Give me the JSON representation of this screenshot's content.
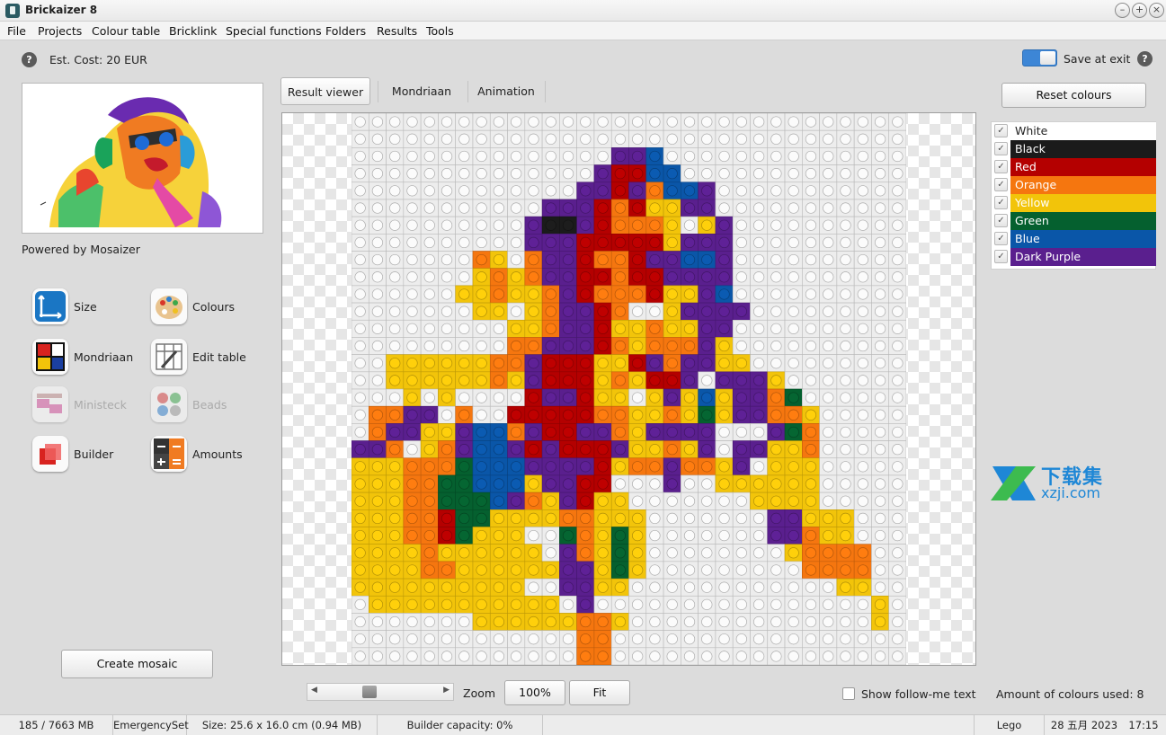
{
  "window": {
    "title": "Brickaizer 8"
  },
  "menu": [
    "File",
    "Projects",
    "Colour table",
    "Bricklink",
    "Special functions",
    "Folders",
    "Results",
    "Tools"
  ],
  "header": {
    "est_cost": "Est. Cost: 20 EUR",
    "save_at_exit": "Save at exit",
    "save_at_exit_on": true
  },
  "left": {
    "powered_by": "Powered by Mosaizer",
    "tools": {
      "size": "Size",
      "colours": "Colours",
      "mondriaan": "Mondriaan",
      "edit_table": "Edit table",
      "ministeck": "Ministeck",
      "beads": "Beads",
      "builder": "Builder",
      "amounts": "Amounts"
    },
    "create_mosaic": "Create mosaic"
  },
  "tabs": [
    "Result viewer",
    "Mondriaan",
    "Animation"
  ],
  "right": {
    "reset_colours": "Reset colours",
    "colours": [
      {
        "name": "White",
        "color": "#ffffff",
        "text": "#222222"
      },
      {
        "name": "Black",
        "color": "#1b1b1b",
        "text": "#ffffff"
      },
      {
        "name": "Red",
        "color": "#b40000",
        "text": "#ffffff"
      },
      {
        "name": "Orange",
        "color": "#f5760f",
        "text": "#ffffff"
      },
      {
        "name": "Yellow",
        "color": "#f2c40a",
        "text": "#ffffff"
      },
      {
        "name": "Green",
        "color": "#05602f",
        "text": "#ffffff"
      },
      {
        "name": "Blue",
        "color": "#0a56a8",
        "text": "#ffffff"
      },
      {
        "name": "Dark Purple",
        "color": "#5a1f8e",
        "text": "#ffffff"
      }
    ]
  },
  "bottom": {
    "zoom_label": "Zoom",
    "zoom_100": "100%",
    "fit": "Fit",
    "show_follow_me": "Show follow-me text",
    "amount_used": "Amount of colours used: 8"
  },
  "status": {
    "memory": "185 / 7663 MB",
    "set": "EmergencySet",
    "size": "Size: 25.6 x 16.0 cm (0.94 MB)",
    "builder_capacity": "Builder capacity: 0%",
    "brand": "Lego",
    "date": "28 五月 2023",
    "time": "17:15"
  },
  "watermark": {
    "line1": "下载集",
    "line2": "xzji.com"
  },
  "mosaic": {
    "cols": 32,
    "rows": 32,
    "palette": {
      "W": "#ededed",
      "K": "#1b1b1b",
      "R": "#b40000",
      "O": "#f5760f",
      "Y": "#f2c40a",
      "G": "#05602f",
      "B": "#0a56a8",
      "P": "#5a1f8e"
    },
    "grid": [
      "WWWWWWWWWWWWWWWWWWWWWWWWWWWWWWWW",
      "WWWWWWWWWWWWWWWWWWWWWWWWWWWWWWWW",
      "WWWWWWWWWWWWWWWPPBWWWWWWWWWWWWWW",
      "WWWWWWWWWWWWWWPRRBBWWWWWWWWWWWWW",
      "WWWWWWWWWWWWWPPRPOBBPWWWWWWWWWWW",
      "WWWWWWWWWWWPPPRORYYPPWWWWWWWWWWW",
      "WWWWWWWWWWPKKPROOOYWYPWWWWWWWWWW",
      "WWWWWWWWWWPPPRRRRRYPPPWWWWWWWWWW",
      "WWWWWWWOYWOPPROORPPBBPWWWWWWWWWW",
      "WWWWWWWYOYOPPRRORRPPPPWWWWWWWWWW",
      "WWWWWWYYOYYOPROOORYYPBWWWWWWWWWW",
      "WWWWWWWYYWYOPPROWWYPPPPWWWWWWWWW",
      "WWWWWWWWWYYOPPRYYOYYPPWWWWWWWWWW",
      "WWWWWWWWWOOPPPROYOOOPYWWWWWWWWWW",
      "WWYYYYYYOOPRRRYYRPOPPYYWWWWWWWWW",
      "WWYYYYYYOYPRRRYOYRRPWPPPYWWWWWWW",
      "WWWYWYWWWWRPPRYYWYPYBYPPOGWWWWWW",
      "WOOPPWOWWRRRRROOYYOYGYPPOOYWWWWW",
      "WOPPYYPBBOPRRPPOYPPPPWWWPGOWWWWW",
      "PPOWYOPBBPRPRRRPYYOYPWPPYYOWWWWW",
      "YYYOOOGBBBPPPPRYOOPOOYPWYYYWWWWW",
      "YYYOOGGBBBYPPRRWWWPWWYYYYYYWWWWW",
      "YYYOOGGGBPOYPRYYWWWWWWWYYYYWWWWW",
      "YYYOORGGYYYYOOYYYWWWWWWWPPYYYWWW",
      "YYYOORGYYYWWGOYGYWWWWWWWPPOYYWWW",
      "YYYYOYYYYYYWPOYGYWWWWWWWWYOOOOWW",
      "YYYYOOYYYYYYPPYGYWWWWWWWWWOOOOWW",
      "YYYYYYYYYYWWPPYYWWWWWWWWWWWWYYWW",
      "WYYYYYYYYYYYWPWWWWWWWWWWWWWWWWYW",
      "WWWWWWWYYYYYYOOYWWWWWWWWWWWWWWYW",
      "WWWWWWWWWWWWWOOWWWWWWWWWWWWWWWWW",
      "WWWWWWWWWWWWWOOWWWWWWWWWWWWWWWWW"
    ]
  }
}
